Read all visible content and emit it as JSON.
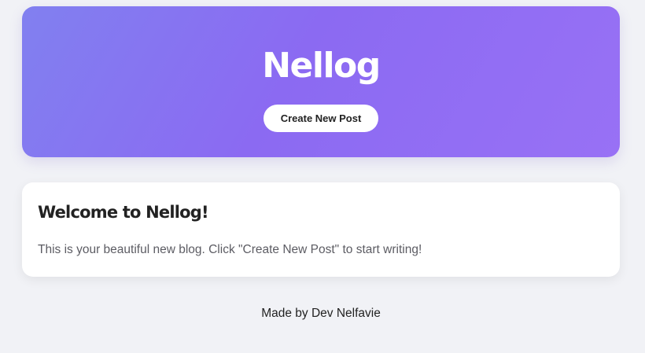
{
  "header": {
    "title": "Nellog",
    "create_button_label": "Create New Post"
  },
  "welcome_card": {
    "title": "Welcome to Nellog!",
    "body": "This is your beautiful new blog. Click \"Create New Post\" to start writing!"
  },
  "footer": {
    "text": "Made by Dev Nelfavie"
  },
  "colors": {
    "background": "#f1f2f6",
    "hero_gradient_start": "#8180f0",
    "hero_gradient_mid": "#8b6af2",
    "hero_gradient_end": "#9871f5",
    "card_background": "#ffffff",
    "text_dark": "#222222",
    "text_muted": "#5c5c63"
  }
}
